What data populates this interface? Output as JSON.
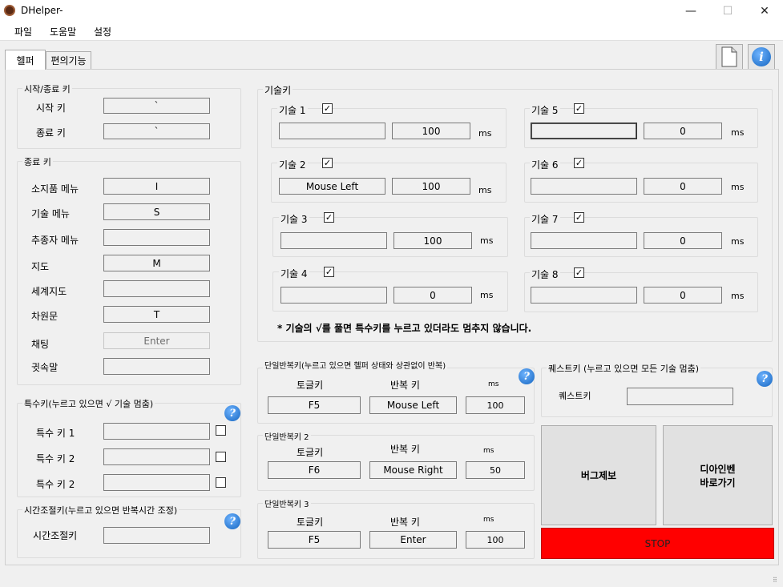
{
  "window": {
    "title": "DHelper-",
    "minimize": "—",
    "maximize": "☐",
    "close": "✕"
  },
  "menu": [
    "파일",
    "도움말",
    "설정"
  ],
  "tabs": [
    "헬퍼",
    "편의기능"
  ],
  "startend": {
    "title": "시작/종료 키",
    "start_label": "시작 키",
    "start_value": "`",
    "end_label": "종료 키",
    "end_value": "`"
  },
  "endkeys": {
    "title": "종료 키",
    "rows": [
      {
        "label": "소지품 메뉴",
        "value": "I"
      },
      {
        "label": "기술 메뉴",
        "value": "S"
      },
      {
        "label": "추종자 메뉴",
        "value": ""
      },
      {
        "label": "지도",
        "value": "M"
      },
      {
        "label": "세계지도",
        "value": ""
      },
      {
        "label": "차원문",
        "value": "T"
      },
      {
        "label": "채팅",
        "value": "Enter"
      },
      {
        "label": "귓속말",
        "value": ""
      }
    ]
  },
  "special": {
    "title": "특수키(누르고 있으면 √ 기술 멈춤)",
    "rows": [
      {
        "label": "특수 키 1",
        "value": ""
      },
      {
        "label": "특수 키 2",
        "value": ""
      },
      {
        "label": "특수 키 2",
        "value": ""
      }
    ]
  },
  "timeadj": {
    "title": "시간조절키(누르고 있으면 반복시간 조정)",
    "label": "시간조절키",
    "value": ""
  },
  "skills": {
    "title": "기술키",
    "unit": "ms",
    "items": [
      {
        "label": "기술 1",
        "checked": "✓",
        "key": "",
        "delay": "100"
      },
      {
        "label": "기술 2",
        "checked": "✓",
        "key": "Mouse Left",
        "delay": "100"
      },
      {
        "label": "기술 3",
        "checked": "✓",
        "key": "",
        "delay": "100"
      },
      {
        "label": "기술 4",
        "checked": "✓",
        "key": "",
        "delay": "0"
      },
      {
        "label": "기술 5",
        "checked": "✓",
        "key": "",
        "delay": "0"
      },
      {
        "label": "기술 6",
        "checked": "✓",
        "key": "",
        "delay": "0"
      },
      {
        "label": "기술 7",
        "checked": "✓",
        "key": "",
        "delay": "0"
      },
      {
        "label": "기술 8",
        "checked": "✓",
        "key": "",
        "delay": "0"
      }
    ],
    "note": "* 기술의 √를 풀면 특수키를 누르고 있더라도 멈추지 않습니다."
  },
  "repeat": [
    {
      "title": "단일반복키(누르고 있으면 헬퍼 상태와 상관없이 반복)",
      "toggle_label": "토글키",
      "repeat_label": "반복 키",
      "ms_label": "ms",
      "toggle": "F5",
      "key": "Mouse Left",
      "ms": "100"
    },
    {
      "title": "단일반복키 2",
      "toggle_label": "토글키",
      "repeat_label": "반복 키",
      "ms_label": "ms",
      "toggle": "F6",
      "key": "Mouse Right",
      "ms": "50"
    },
    {
      "title": "단일반복키 3",
      "toggle_label": "토글키",
      "repeat_label": "반복 키",
      "ms_label": "ms",
      "toggle": "F5",
      "key": "Enter",
      "ms": "100"
    }
  ],
  "quest": {
    "title": "퀘스트키 (누르고 있으면 모든 기술 멈춤)",
    "label": "퀘스트키",
    "value": ""
  },
  "buttons": {
    "bug": "버그제보",
    "go1": "디아인벤",
    "go2": "바로가기",
    "stop": "STOP"
  },
  "help_glyph": "?",
  "info_glyph": "i",
  "grip_glyph": "⠿"
}
